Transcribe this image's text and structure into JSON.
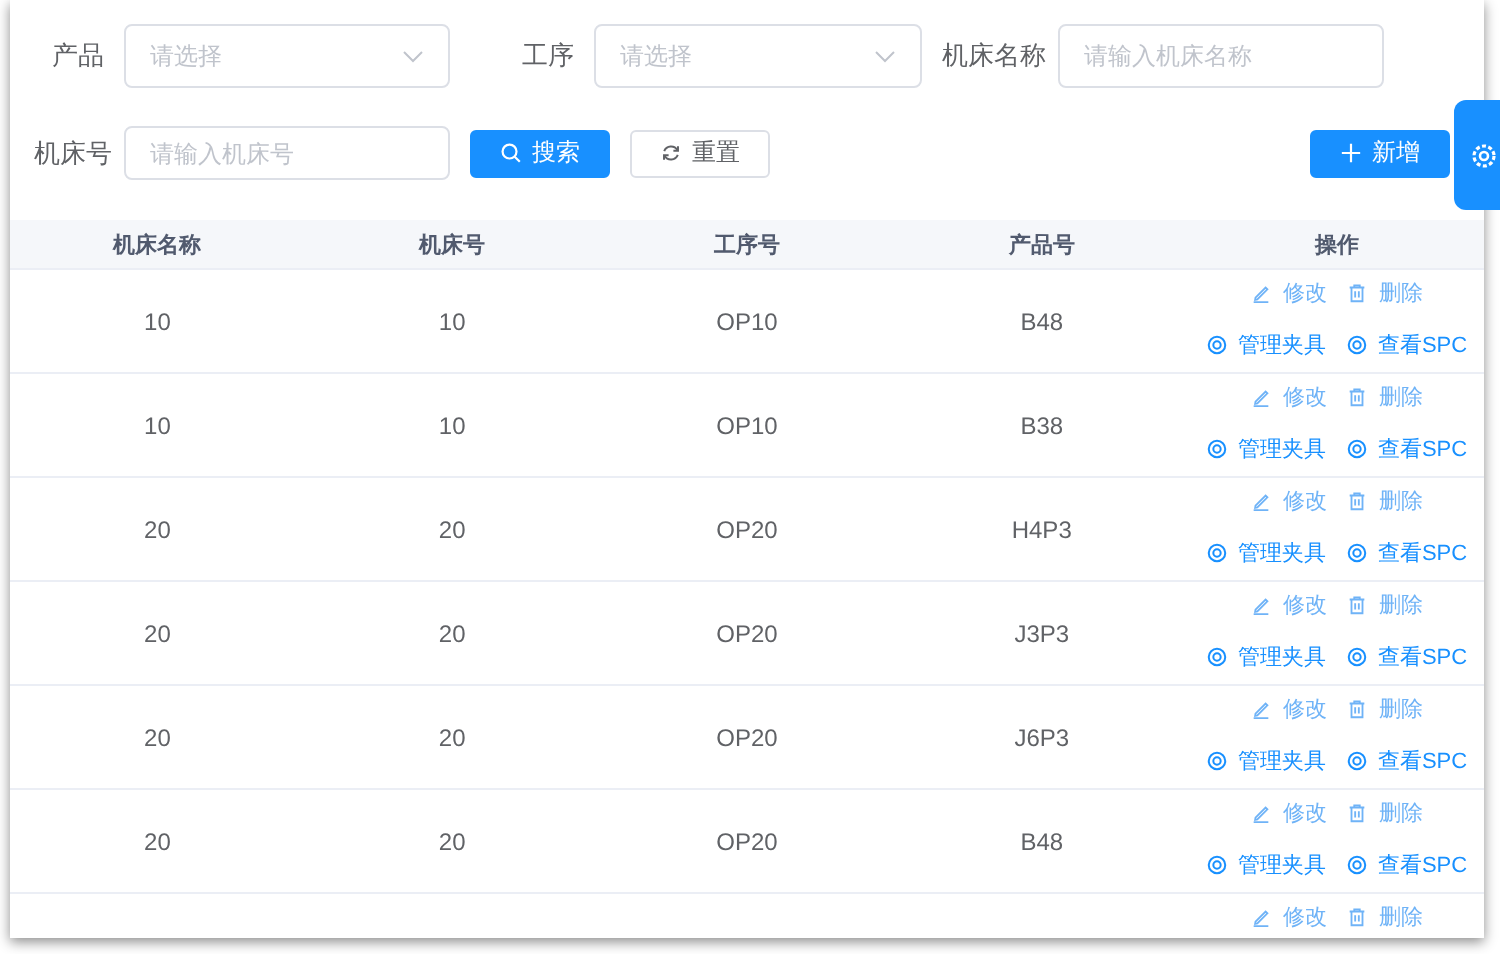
{
  "filters": [
    {
      "label": "产品",
      "kind": "select",
      "placeholder": "请选择"
    },
    {
      "label": "工序",
      "kind": "select",
      "placeholder": "请选择"
    },
    {
      "label": "机床名称",
      "kind": "input",
      "placeholder": "请输入机床名称"
    },
    {
      "label": "机床号",
      "kind": "input",
      "placeholder": "请输入机床号"
    }
  ],
  "buttons": [
    {
      "kind": "search",
      "label": "搜索"
    },
    {
      "kind": "reset",
      "label": "重置"
    },
    {
      "kind": "add",
      "label": "新增"
    }
  ],
  "table": {
    "columns": [
      "机床名称",
      "机床号",
      "工序号",
      "产品号",
      "操作"
    ],
    "rows": [
      {
        "cells": [
          "10",
          "10",
          "OP10",
          "B48"
        ],
        "actions": [
          {
            "kind": "edit",
            "label": "修改"
          },
          {
            "kind": "delete",
            "label": "删除"
          },
          {
            "kind": "fixture",
            "label": "管理夹具"
          },
          {
            "kind": "spc",
            "label": "查看SPC"
          }
        ]
      },
      {
        "cells": [
          "10",
          "10",
          "OP10",
          "B38"
        ],
        "actions": [
          {
            "kind": "edit",
            "label": "修改"
          },
          {
            "kind": "delete",
            "label": "删除"
          },
          {
            "kind": "fixture",
            "label": "管理夹具"
          },
          {
            "kind": "spc",
            "label": "查看SPC"
          }
        ]
      },
      {
        "cells": [
          "20",
          "20",
          "OP20",
          "H4P3"
        ],
        "actions": [
          {
            "kind": "edit",
            "label": "修改"
          },
          {
            "kind": "delete",
            "label": "删除"
          },
          {
            "kind": "fixture",
            "label": "管理夹具"
          },
          {
            "kind": "spc",
            "label": "查看SPC"
          }
        ]
      },
      {
        "cells": [
          "20",
          "20",
          "OP20",
          "J3P3"
        ],
        "actions": [
          {
            "kind": "edit",
            "label": "修改"
          },
          {
            "kind": "delete",
            "label": "删除"
          },
          {
            "kind": "fixture",
            "label": "管理夹具"
          },
          {
            "kind": "spc",
            "label": "查看SPC"
          }
        ]
      },
      {
        "cells": [
          "20",
          "20",
          "OP20",
          "J6P3"
        ],
        "actions": [
          {
            "kind": "edit",
            "label": "修改"
          },
          {
            "kind": "delete",
            "label": "删除"
          },
          {
            "kind": "fixture",
            "label": "管理夹具"
          },
          {
            "kind": "spc",
            "label": "查看SPC"
          }
        ]
      },
      {
        "cells": [
          "20",
          "20",
          "OP20",
          "B48"
        ],
        "actions": [
          {
            "kind": "edit",
            "label": "修改"
          },
          {
            "kind": "delete",
            "label": "删除"
          },
          {
            "kind": "fixture",
            "label": "管理夹具"
          },
          {
            "kind": "spc",
            "label": "查看SPC"
          }
        ]
      },
      {
        "actions": [
          {
            "kind": "edit",
            "label": "修改"
          },
          {
            "kind": "delete",
            "label": "删除"
          }
        ]
      }
    ]
  }
}
